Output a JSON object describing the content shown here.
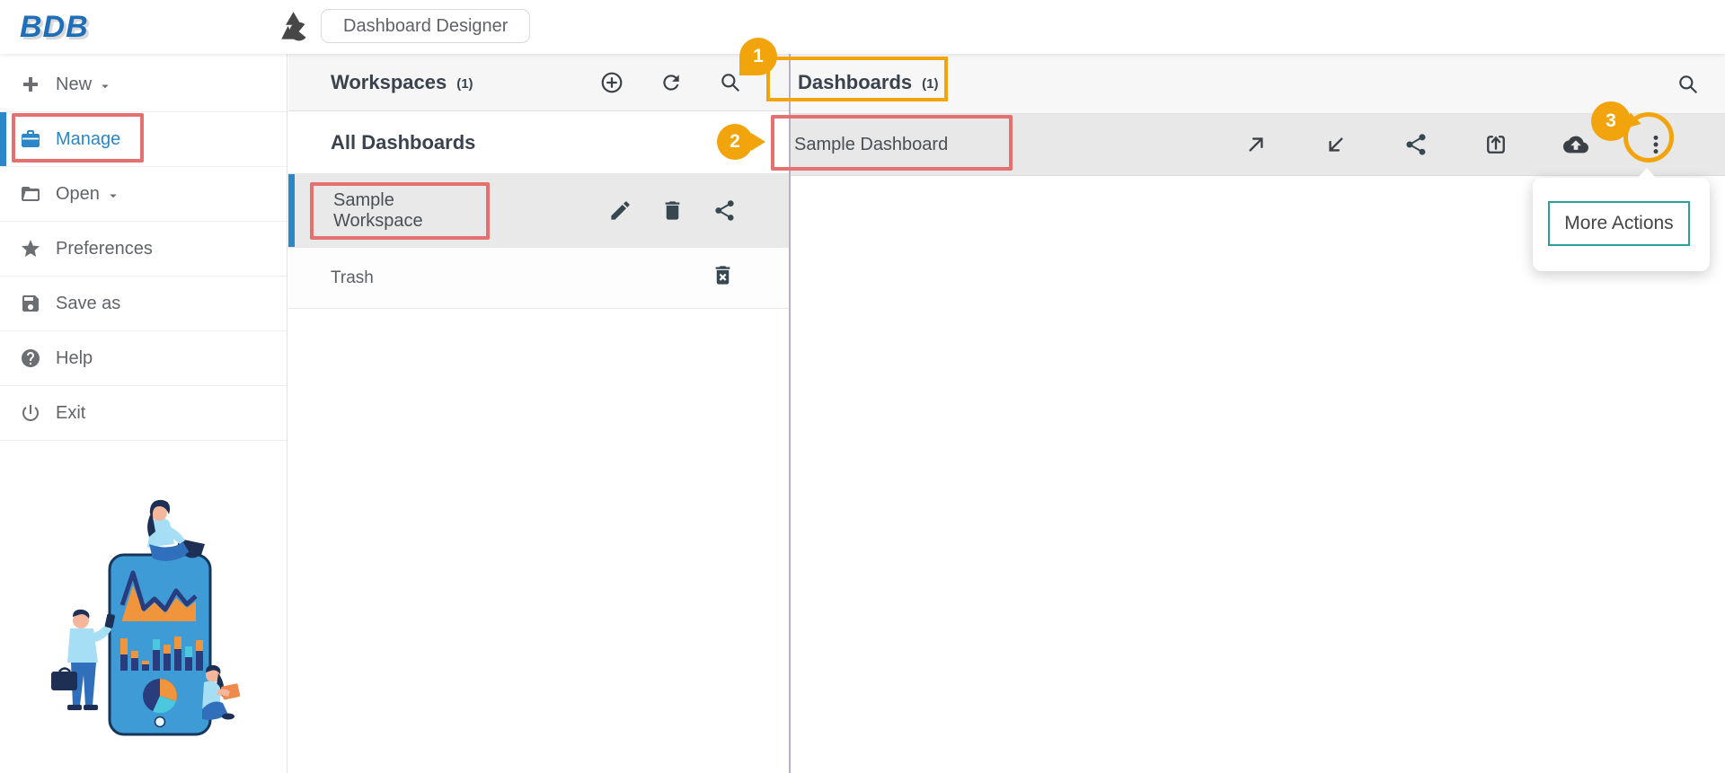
{
  "topbar": {
    "logo_text": "BDB",
    "app_title": "Dashboard Designer"
  },
  "sidebar": {
    "items": [
      {
        "label": "New",
        "icon": "plus-icon",
        "caret": true,
        "active": false
      },
      {
        "label": "Manage",
        "icon": "briefcase-icon",
        "caret": false,
        "active": true
      },
      {
        "label": "Open",
        "icon": "folder-open-icon",
        "caret": true,
        "active": false
      },
      {
        "label": "Preferences",
        "icon": "star-icon",
        "caret": false,
        "active": false
      },
      {
        "label": "Save as",
        "icon": "save-icon",
        "caret": false,
        "active": false
      },
      {
        "label": "Help",
        "icon": "help-icon",
        "caret": false,
        "active": false
      },
      {
        "label": "Exit",
        "icon": "power-icon",
        "caret": false,
        "active": false
      }
    ]
  },
  "workspaces_panel": {
    "title": "Workspaces",
    "count": "(1)",
    "header_icons": [
      "add-circle-icon",
      "refresh-icon",
      "search-icon"
    ],
    "rows": [
      {
        "label": "All Dashboards"
      },
      {
        "label": "Sample Workspace",
        "selected": true,
        "icons": [
          "edit-icon",
          "delete-icon",
          "share-icon"
        ]
      },
      {
        "label": "Trash",
        "icons": [
          "delete-forever-icon"
        ]
      }
    ]
  },
  "dashboards_panel": {
    "title": "Dashboards",
    "count": "(1)",
    "header_icons": [
      "search-icon"
    ],
    "rows": [
      {
        "label": "Sample Dashboard",
        "icons": [
          "open-external-icon",
          "import-icon",
          "share-icon",
          "open-in-browser-icon",
          "cloud-upload-icon",
          "more-vert-icon"
        ]
      }
    ]
  },
  "more_actions_popup": {
    "label": "More Actions"
  },
  "annotations": {
    "steps": [
      "1",
      "2",
      "3"
    ],
    "colors": {
      "highlight_orange": "#F1A40B",
      "highlight_red": "#E57070",
      "accent_teal": "#2AA198"
    }
  },
  "colors": {
    "brand_blue": "#1E6FB8",
    "active_blue": "#2B87C8",
    "panel_header_bg": "#F6F6F6",
    "selected_row_bg": "#E9E9E9",
    "divider_purple": "#B9B0C7"
  }
}
